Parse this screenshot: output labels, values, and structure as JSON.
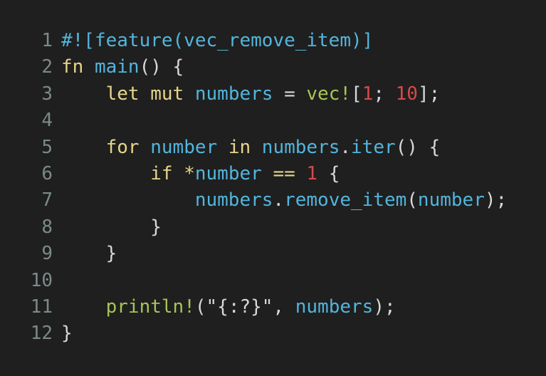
{
  "colors": {
    "background": "#1f1f1f",
    "line_number": "#7b8a8a",
    "plain": "#d8d8d8",
    "keyword": "#e6d58a",
    "identifier": "#52b5dc",
    "macro": "#a7c556",
    "number_literal": "#d64a4a",
    "attribute": "#52b5dc"
  },
  "lines": [
    {
      "num": "1",
      "tokens": [
        {
          "t": "#![feature(vec_remove_item)]",
          "c": "attribute"
        }
      ]
    },
    {
      "num": "2",
      "tokens": [
        {
          "t": "fn",
          "c": "keyword"
        },
        {
          "t": " ",
          "c": "plain"
        },
        {
          "t": "main",
          "c": "identifier"
        },
        {
          "t": "() {",
          "c": "plain"
        }
      ]
    },
    {
      "num": "3",
      "tokens": [
        {
          "t": "    ",
          "c": "plain"
        },
        {
          "t": "let mut",
          "c": "keyword"
        },
        {
          "t": " ",
          "c": "plain"
        },
        {
          "t": "numbers",
          "c": "identifier"
        },
        {
          "t": " = ",
          "c": "plain"
        },
        {
          "t": "vec!",
          "c": "macro"
        },
        {
          "t": "[",
          "c": "plain"
        },
        {
          "t": "1",
          "c": "number_literal"
        },
        {
          "t": "; ",
          "c": "plain"
        },
        {
          "t": "10",
          "c": "number_literal"
        },
        {
          "t": "];",
          "c": "plain"
        }
      ]
    },
    {
      "num": "4",
      "tokens": []
    },
    {
      "num": "5",
      "tokens": [
        {
          "t": "    ",
          "c": "plain"
        },
        {
          "t": "for",
          "c": "keyword"
        },
        {
          "t": " ",
          "c": "plain"
        },
        {
          "t": "number",
          "c": "identifier"
        },
        {
          "t": " ",
          "c": "plain"
        },
        {
          "t": "in",
          "c": "keyword"
        },
        {
          "t": " ",
          "c": "plain"
        },
        {
          "t": "numbers",
          "c": "identifier"
        },
        {
          "t": ".",
          "c": "plain"
        },
        {
          "t": "iter",
          "c": "identifier"
        },
        {
          "t": "() {",
          "c": "plain"
        }
      ]
    },
    {
      "num": "6",
      "tokens": [
        {
          "t": "        ",
          "c": "plain"
        },
        {
          "t": "if",
          "c": "keyword"
        },
        {
          "t": " ",
          "c": "plain"
        },
        {
          "t": "*",
          "c": "keyword"
        },
        {
          "t": "number",
          "c": "identifier"
        },
        {
          "t": " ",
          "c": "plain"
        },
        {
          "t": "==",
          "c": "keyword"
        },
        {
          "t": " ",
          "c": "plain"
        },
        {
          "t": "1",
          "c": "number_literal"
        },
        {
          "t": " {",
          "c": "plain"
        }
      ]
    },
    {
      "num": "7",
      "tokens": [
        {
          "t": "            ",
          "c": "plain"
        },
        {
          "t": "numbers",
          "c": "identifier"
        },
        {
          "t": ".",
          "c": "plain"
        },
        {
          "t": "remove_item",
          "c": "identifier"
        },
        {
          "t": "(",
          "c": "plain"
        },
        {
          "t": "number",
          "c": "identifier"
        },
        {
          "t": ");",
          "c": "plain"
        }
      ]
    },
    {
      "num": "8",
      "tokens": [
        {
          "t": "        }",
          "c": "plain"
        }
      ]
    },
    {
      "num": "9",
      "tokens": [
        {
          "t": "    }",
          "c": "plain"
        }
      ]
    },
    {
      "num": "10",
      "tokens": []
    },
    {
      "num": "11",
      "tokens": [
        {
          "t": "    ",
          "c": "plain"
        },
        {
          "t": "println!",
          "c": "macro"
        },
        {
          "t": "(\"{:?}\", ",
          "c": "plain"
        },
        {
          "t": "numbers",
          "c": "identifier"
        },
        {
          "t": ");",
          "c": "plain"
        }
      ]
    },
    {
      "num": "12",
      "tokens": [
        {
          "t": "}",
          "c": "plain"
        }
      ]
    }
  ]
}
